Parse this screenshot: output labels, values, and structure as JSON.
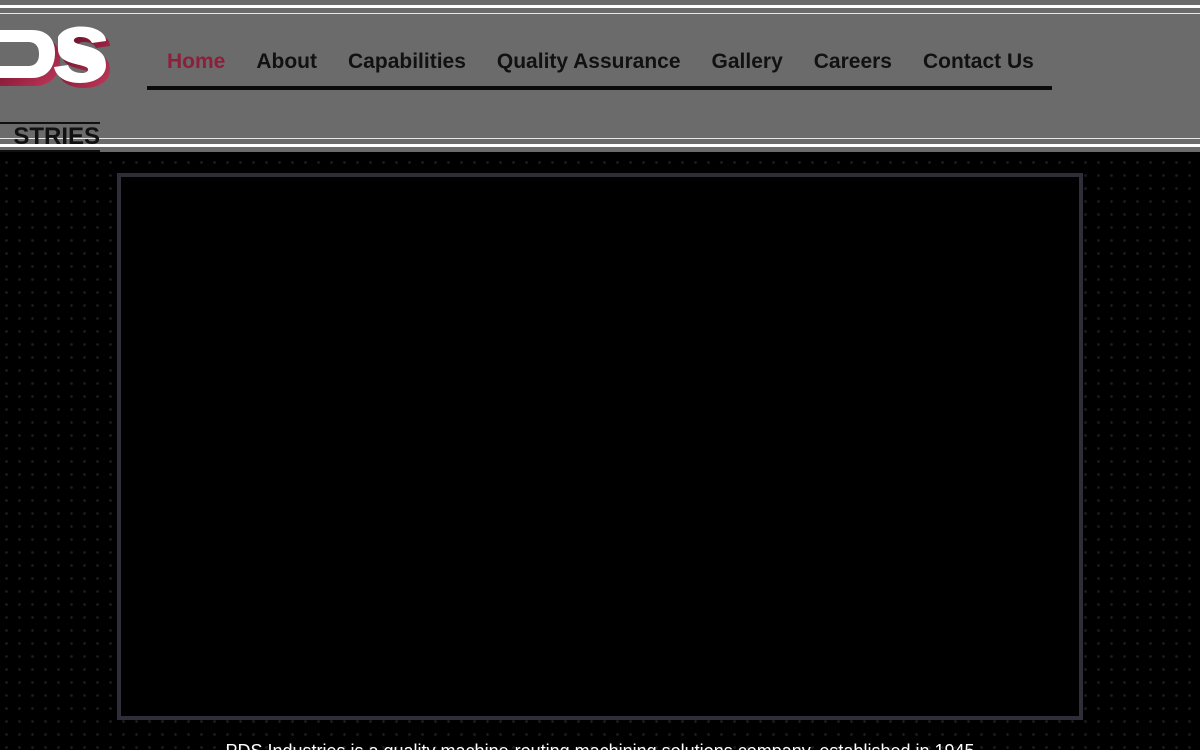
{
  "brand": {
    "logo_top_letters": "DS",
    "logo_bottom_text": "STRIES",
    "colors": {
      "header_bg": "#6b6b6b",
      "accent": "#8c1f3c",
      "nav_text": "#111111",
      "page_bg": "#000000",
      "frame_border": "#2f2e38"
    }
  },
  "nav": {
    "items": [
      {
        "label": "Home",
        "active": true
      },
      {
        "label": "About",
        "active": false
      },
      {
        "label": "Capabilities",
        "active": false
      },
      {
        "label": "Quality Assurance",
        "active": false
      },
      {
        "label": "Gallery",
        "active": false
      },
      {
        "label": "Careers",
        "active": false
      },
      {
        "label": "Contact Us",
        "active": false
      }
    ]
  },
  "intro": {
    "text": "PDS Industries is a quality machine-routing machining solutions company, established in 1945"
  }
}
